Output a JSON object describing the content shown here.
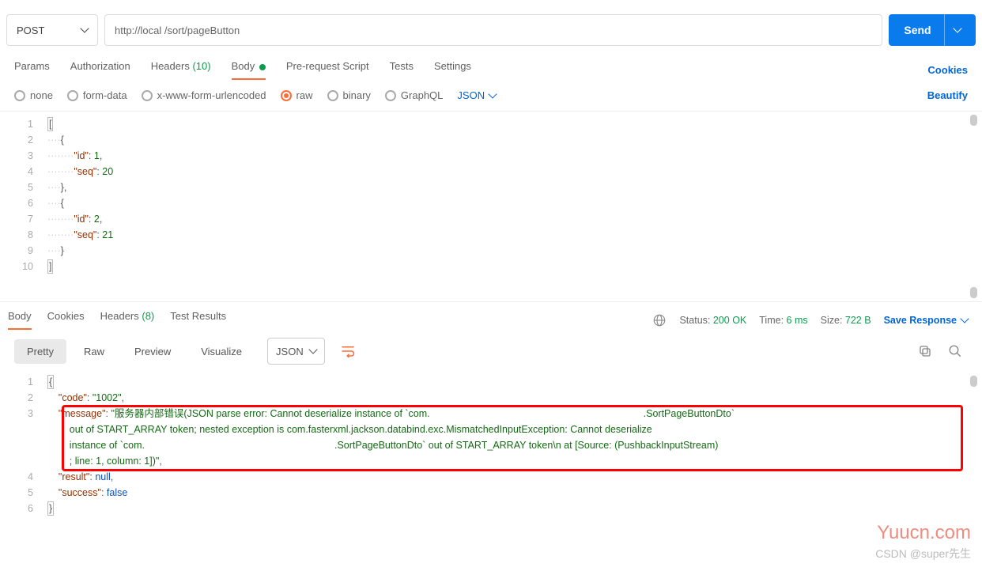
{
  "request": {
    "method": "POST",
    "url_display": "http://local                                /sort/pageButton",
    "send_label": "Send"
  },
  "req_tabs": {
    "params": "Params",
    "authorization": "Authorization",
    "headers": "Headers",
    "headers_count": "(10)",
    "body": "Body",
    "pre_request": "Pre-request Script",
    "tests": "Tests",
    "settings": "Settings",
    "cookies": "Cookies"
  },
  "body_types": {
    "none": "none",
    "form_data": "form-data",
    "x_www": "x-www-form-urlencoded",
    "raw": "raw",
    "binary": "binary",
    "graphql": "GraphQL",
    "selected_format": "JSON",
    "beautify": "Beautify"
  },
  "request_body_lines": {
    "l1": "[",
    "l2_guide": "····",
    "l2": "{",
    "l3_guide": "········",
    "l3_k": "\"id\"",
    "l3_v": "1",
    "l3_s": ": ",
    "l3_c": ",",
    "l4_guide": "········",
    "l4_k": "\"seq\"",
    "l4_v": "20",
    "l4_s": ": ",
    "l5_guide": "····",
    "l5": "},",
    "l6_guide": "····",
    "l6": "{",
    "l7_guide": "········",
    "l7_k": "\"id\"",
    "l7_v": "2",
    "l7_s": ": ",
    "l7_c": ",",
    "l8_guide": "········",
    "l8_k": "\"seq\"",
    "l8_v": "21",
    "l8_s": ": ",
    "l9_guide": "····",
    "l9": "}",
    "l10": "]"
  },
  "resp_tabs": {
    "body": "Body",
    "cookies": "Cookies",
    "headers": "Headers",
    "headers_count": "(8)",
    "test_results": "Test Results"
  },
  "status": {
    "status_label": "Status:",
    "status_value": "200 OK",
    "time_label": "Time:",
    "time_value": "6 ms",
    "size_label": "Size:",
    "size_value": "722 B",
    "save_response": "Save Response"
  },
  "resp_toolbar": {
    "pretty": "Pretty",
    "raw": "Raw",
    "preview": "Preview",
    "visualize": "Visualize",
    "format": "JSON"
  },
  "response_body": {
    "l1": "{",
    "l2_k": "\"code\"",
    "l2_v": "\"1002\"",
    "l2_s": ": ",
    "l2_c": ",",
    "l3_k": "\"message\"",
    "l3_s": ": ",
    "l3_v_a": "\"服务器内部错误(JSON parse error: Cannot deserialize instance of `com.",
    "l3_v_b": ".SortPageButtonDto` ",
    "l3_line2": "out of START_ARRAY token; nested exception is com.fasterxml.jackson.databind.exc.MismatchedInputException: Cannot deserialize ",
    "l3_line3a": "instance of `com.",
    "l3_line3b": ".SortPageButtonDto` out of START_ARRAY token\\n at [Source: (PushbackInputStream)",
    "l3_line4": "; line: 1, column: 1])\"",
    "l3_c": ",",
    "l4_k": "\"result\"",
    "l4_s": ": ",
    "l4_v": "null",
    "l4_c": ",",
    "l5_k": "\"success\"",
    "l5_s": ": ",
    "l5_v": "false",
    "l6": "}"
  },
  "footer": {
    "watermark": "Yuucn.com",
    "csdn": "CSDN @super先生"
  }
}
